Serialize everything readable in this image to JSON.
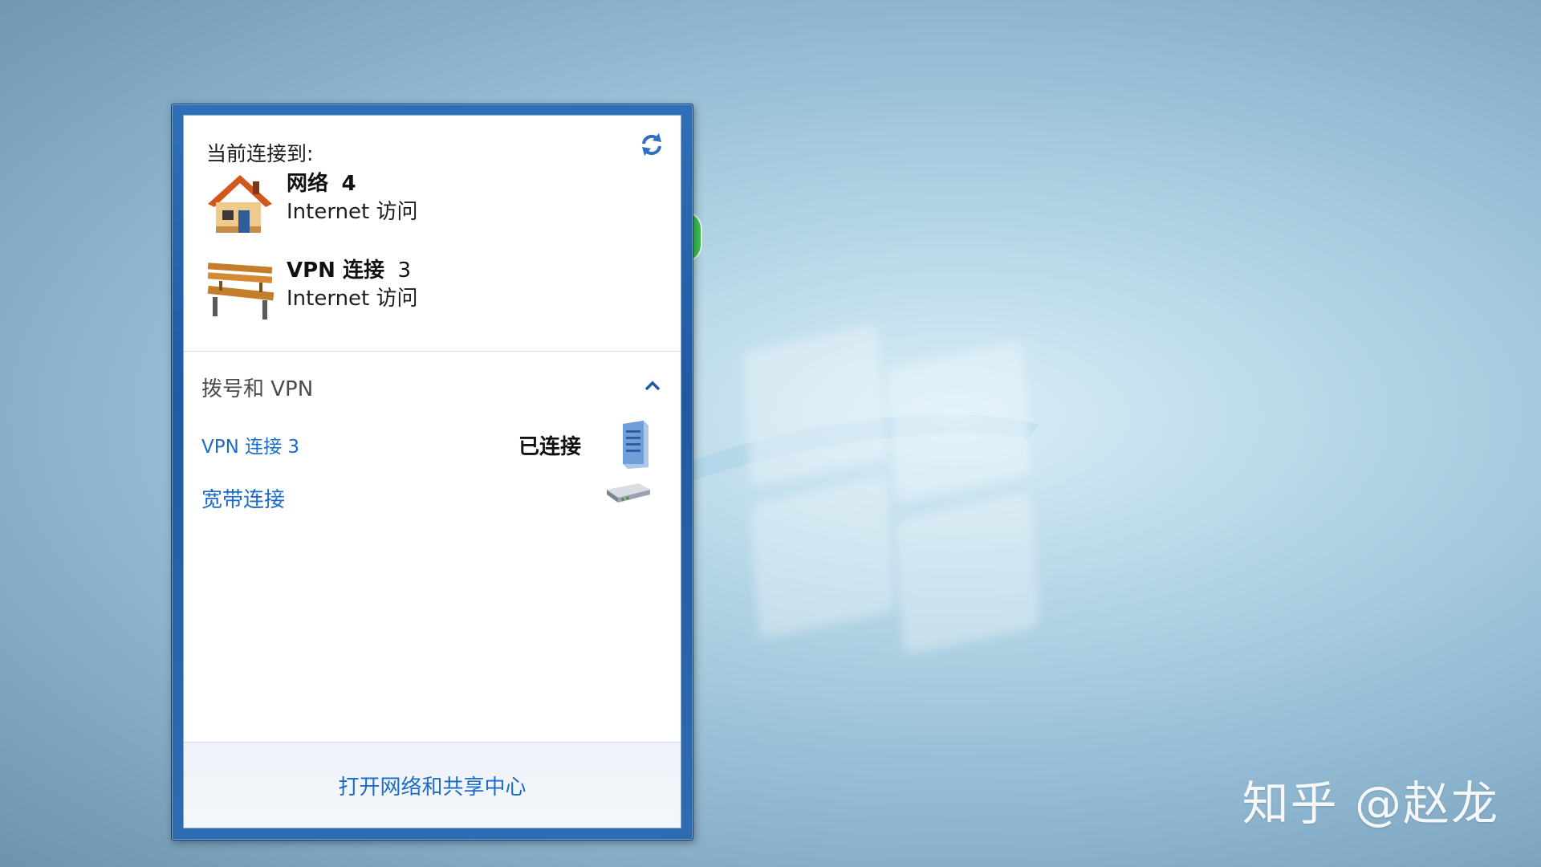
{
  "popup": {
    "header": "当前连接到:",
    "refresh_icon": "refresh-icon",
    "connections": [
      {
        "name": "网络",
        "suffix": "4",
        "access": "Internet 访问",
        "icon": "home-network-icon"
      },
      {
        "name": "VPN 连接",
        "suffix": "3",
        "access": "Internet 访问",
        "icon": "bench-vpn-icon"
      }
    ],
    "section_title": "拨号和 VPN",
    "collapse_icon": "chevron-up-icon",
    "dialup_list": [
      {
        "label": "VPN 连接 3",
        "status": "已连接",
        "icon": "server-icon"
      },
      {
        "label": "宽带连接",
        "status": "",
        "icon": "modem-icon"
      }
    ],
    "footer_link": "打开网络和共享中心"
  },
  "watermark": "知乎 @赵龙",
  "colors": {
    "link": "#1c6cc7",
    "frame": "#1f5aa5"
  }
}
